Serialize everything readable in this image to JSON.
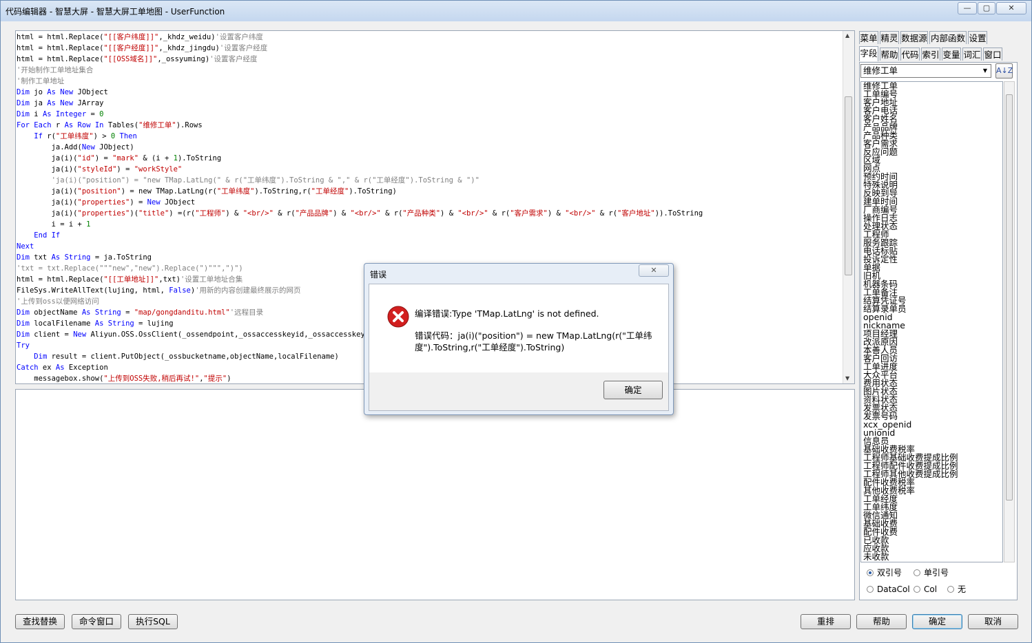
{
  "window": {
    "title": "代码编辑器 - 智慧大屏 - 智慧大屏工单地图 - UserFunction"
  },
  "code_lines": [
    "html = html.Replace(\"[[客户纬度]]\",_khdz_weidu)'设置客户纬度",
    "html = html.Replace(\"[[客户经度]]\",_khdz_jingdu)'设置客户经度",
    "html = html.Replace(\"[[OSS域名]]\",_ossyuming)'设置客户经度",
    "'开始制作工单地址集合",
    "'制作工单地址",
    "Dim jo As New JObject",
    "Dim ja As New JArray",
    "Dim i As Integer = 0",
    "For Each r As Row In Tables(\"维修工单\").Rows",
    "    If r(\"工单纬度\") > 0 Then",
    "        ja.Add(New JObject)",
    "        ja(i)(\"id\") = \"mark\" & (i + 1).ToString",
    "        ja(i)(\"styleId\") = \"workStyle\"",
    "        'ja(i)(\"position\") = \"new TMap.LatLng(\" & r(\"工单纬度\").ToString & \",\" & r(\"工单经度\").ToString & \")\"",
    "        ja(i)(\"position\") = new TMap.LatLng(r(\"工单纬度\").ToString,r(\"工单经度\").ToString)",
    "        ja(i)(\"properties\") = New JObject",
    "        ja(i)(\"properties\")(\"title\") =(r(\"工程师\") & \"<br/>\" & r(\"产品品牌\") & \"<br/>\" & r(\"产品种类\") & \"<br/>\" & r(\"客户需求\") & \"<br/>\" & r(\"客户地址\")).ToString",
    "        i = i + 1",
    "    End If",
    "Next",
    "Dim txt As String = ja.ToString",
    "'txt = txt.Replace(\"\"\"new\",\"new\").Replace(\")\"\"\",\")\")",
    "html = html.Replace(\"[[工单地址]]\",txt)'设置工单地址合集",
    "FileSys.WriteAllText(lujing, html, False)'用新的内容创建最终展示的网页",
    "'上传到oss以便网络访问",
    "Dim objectName As String = \"map/gongdanditu.html\"'远程目录",
    "Dim localFilename As String = lujing",
    "Dim client = New Aliyun.OSS.OssClient(_ossendpoint,_ossaccesskeyid,_ossaccesskeysecr",
    "Try",
    "    Dim result = client.PutObject(_ossbucketname,objectName,localFilename)",
    "Catch ex As Exception",
    "    messagebox.show(\"上传到OSS失败,稍后再试!\",\"提示\")"
  ],
  "right_panel": {
    "tabs_row1": [
      "菜单",
      "精灵",
      "数据源",
      "内部函数",
      "设置"
    ],
    "tabs_row2": [
      "字段",
      "帮助",
      "代码",
      "索引",
      "变量",
      "词汇",
      "窗口"
    ],
    "table_select": "维修工单",
    "fields": [
      "维修工单",
      "工单编号",
      "客户地址",
      "客户电话",
      "客户姓名",
      "产品品牌",
      "产品种类",
      "客户需求",
      "反应问题",
      "区域",
      "网点",
      "预约时间",
      "特殊说明",
      "反映到导",
      "建单时间",
      "厂商编号",
      "操作日志",
      "处理状态",
      "工程师",
      "服务跟踪",
      "电话标贴",
      "投诉定性",
      "单据",
      "旧机",
      "机器条码",
      "工单备注",
      "结算凭证号",
      "结算录单员",
      "openid",
      "nickname",
      "项目经理",
      "改派原因",
      "本善人员",
      "客户回访",
      "工单进度",
      "大众平台",
      "费用状态",
      "图片状态",
      "资料状态",
      "发票状态",
      "发票号码",
      "xcx_openid",
      "unionid",
      "信息员",
      "基础收费税率",
      "工程师基础收费提成比例",
      "工程师配件收费提成比例",
      "工程师其他收费提成比例",
      "配件收费税率",
      "其他收费税率",
      "工单经度",
      "工单纬度",
      "微信通知",
      "基础收费",
      "配件收费",
      "已收款",
      "应收款",
      "未收款"
    ],
    "radios": [
      {
        "label": "双引号",
        "checked": true
      },
      {
        "label": "单引号",
        "checked": false
      },
      {
        "label": "DataCol",
        "checked": false
      },
      {
        "label": "Col",
        "checked": false
      },
      {
        "label": "无",
        "checked": false
      }
    ]
  },
  "bottom_buttons": {
    "find_replace": "查找替换",
    "command_window": "命令窗口",
    "execute_sql": "执行SQL",
    "rearrange": "重排",
    "help": "帮助",
    "ok": "确定",
    "cancel": "取消"
  },
  "dialog": {
    "title": "错误",
    "message": "编译错误:Type 'TMap.LatLng' is not defined.",
    "code_prefix": "错误代码：",
    "code_text": "ja(i)(\"position\") = new TMap.LatLng(r(\"工单纬度\").ToString,r(\"工单经度\").ToString)",
    "ok_label": "确定"
  },
  "colors": {
    "keyword": "#0000ff",
    "string": "#c00000",
    "comment": "#808080",
    "error_icon": "#d21f1f"
  }
}
